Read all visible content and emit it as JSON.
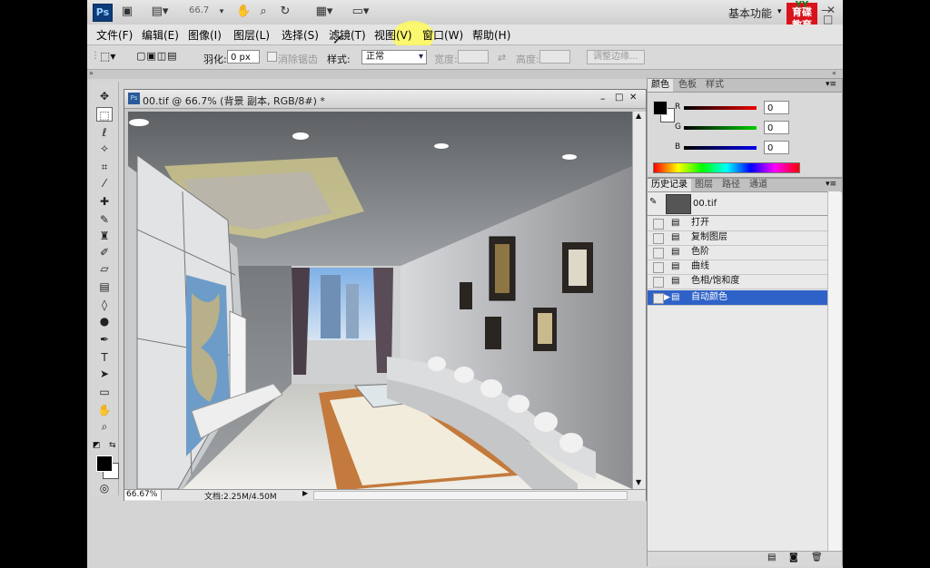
{
  "appbar": {
    "logo": "Ps",
    "zoom": "66.7",
    "workspace": "基本功能",
    "brand_top": "YY",
    "brand_line1": "育碟",
    "brand_line2": "教育",
    "minimize": "—",
    "restore": "□",
    "close": "✕"
  },
  "menu": [
    "文件(F)",
    "编辑(E)",
    "图像(I)",
    "图层(L)",
    "选择(S)",
    "滤镜(T)",
    "视图(V)",
    "窗口(W)",
    "帮助(H)"
  ],
  "options": {
    "feather_label": "羽化:",
    "feather_value": "0 px",
    "antialias_label": "消除锯齿",
    "style_label": "样式:",
    "style_value": "正常",
    "width_label": "宽度:",
    "height_label": "高度:",
    "refine_button": "调整边缘..."
  },
  "document": {
    "title": "00.tif @ 66.7% (背景 副本, RGB/8#) *",
    "zoom_status": "66.67%",
    "doc_size": "文档:2.25M/4.50M"
  },
  "color_panel": {
    "tabs": [
      "颜色",
      "色板",
      "样式"
    ],
    "channels": [
      {
        "name": "R",
        "value": "0"
      },
      {
        "name": "G",
        "value": "0"
      },
      {
        "name": "B",
        "value": "0"
      }
    ]
  },
  "history_panel": {
    "tabs": [
      "历史记录",
      "图层",
      "路径",
      "通道"
    ],
    "snapshot": "00.tif",
    "items": [
      "打开",
      "复制图层",
      "色阶",
      "曲线",
      "色相/饱和度",
      "自动颜色"
    ]
  },
  "colors": {
    "selected_row": "#2f62c8",
    "foreground": "#000000",
    "background": "#ffffff"
  }
}
